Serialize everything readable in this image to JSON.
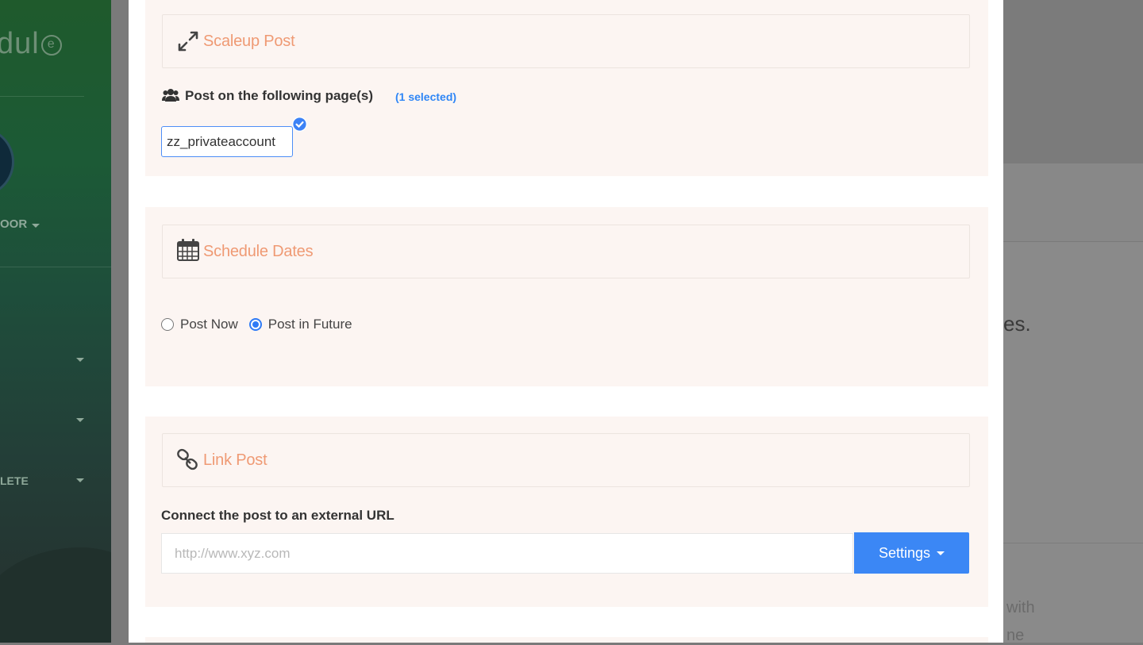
{
  "background": {
    "logo_text": "dul",
    "logo_mark": "e",
    "sidebar_labels": [
      "OOR",
      "",
      "",
      "LETE"
    ],
    "main_text_1": "es.",
    "main_text_2": "with",
    "main_text_3": "ne"
  },
  "scaleup": {
    "title": "Scaleup Post",
    "icon": "expand-arrows-icon",
    "pages_label": "Post on the following page(s)",
    "selected_count": "(1 selected)",
    "pages": [
      "zz_privateaccount"
    ]
  },
  "schedule": {
    "title": "Schedule Dates",
    "icon": "calendar-icon",
    "options": [
      {
        "label": "Post Now",
        "checked": false
      },
      {
        "label": "Post in Future",
        "checked": true
      }
    ]
  },
  "link_post": {
    "title": "Link Post",
    "icon": "link-icon",
    "description": "Connect the post to an external URL",
    "url_placeholder": "http://www.xyz.com",
    "url_value": "",
    "settings_label": "Settings"
  },
  "colors": {
    "accent_title": "#ef9a74",
    "primary": "#3b87f5",
    "section_bg": "#fcf5f2"
  }
}
